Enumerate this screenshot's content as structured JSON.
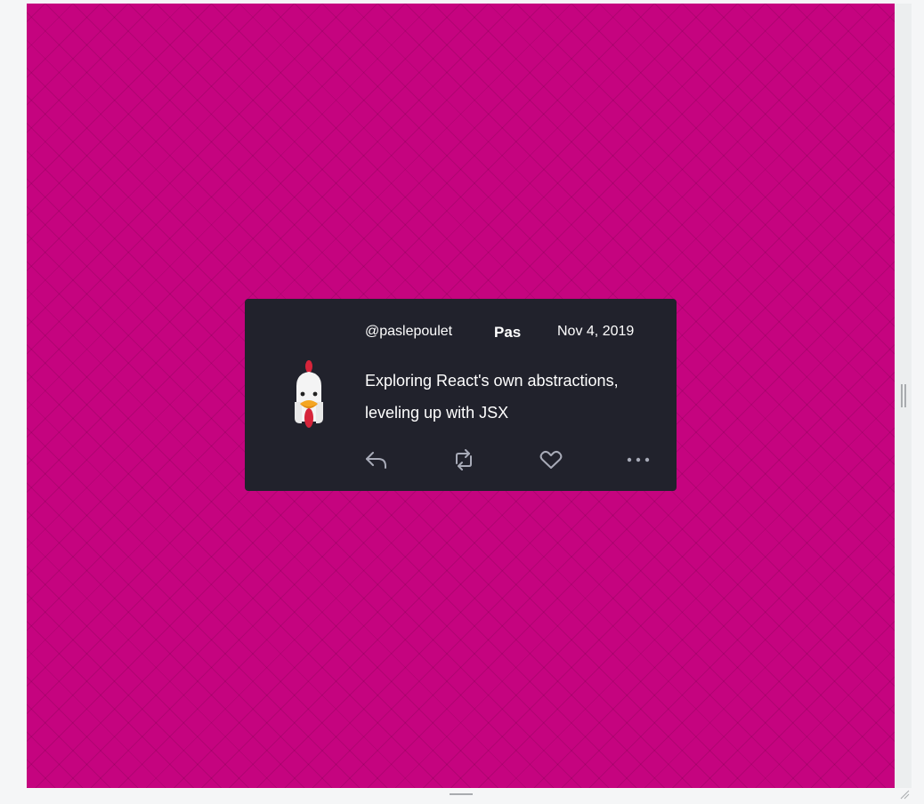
{
  "tweet": {
    "handle": "@paslepoulet",
    "display_name": "Pas",
    "date": "Nov 4, 2019",
    "text_line1": "Exploring React's own abstractions,",
    "text_line2": "leveling up with JSX",
    "avatar_icon": "chicken-icon"
  },
  "actions": {
    "reply_icon": "reply-icon",
    "retweet_icon": "retweet-icon",
    "like_icon": "heart-icon",
    "more_icon": "more-icon"
  },
  "colors": {
    "background": "#c5047f",
    "card": "#21222c",
    "text": "#ffffff",
    "action_icon": "#a8abb8"
  }
}
